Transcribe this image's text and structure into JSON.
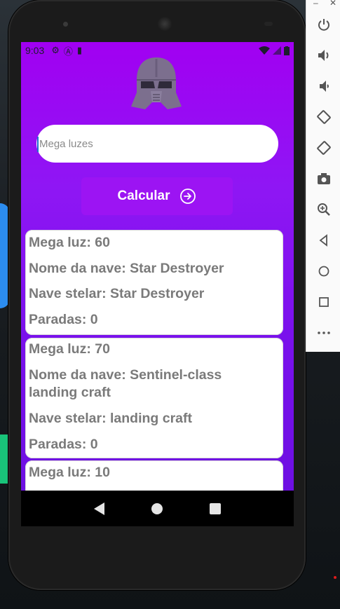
{
  "status_bar": {
    "time": "9:03"
  },
  "search": {
    "placeholder": "Mega luzes",
    "value": ""
  },
  "calculate_button": {
    "label": "Calcular"
  },
  "results": [
    {
      "lines": [
        "Mega luz: 60",
        "Nome da nave: Star Destroyer",
        "Nave stelar: Star Destroyer",
        "Paradas: 0"
      ]
    },
    {
      "lines": [
        "Mega luz: 70",
        "Nome da nave: Sentinel-class landing craft",
        "Nave stelar: landing craft",
        "Paradas: 0"
      ]
    },
    {
      "lines": [
        "Mega luz: 10"
      ]
    }
  ],
  "emulator_toolbar": {
    "items": [
      "power-icon",
      "volume-up-icon",
      "volume-down-icon",
      "rotate-left-icon",
      "rotate-right-icon",
      "camera-icon",
      "zoom-icon",
      "back-icon",
      "home-icon",
      "overview-icon",
      "more-icon"
    ]
  },
  "colors": {
    "accent": "#9c14f3",
    "screen_top": "#a100f2",
    "screen_bottom": "#6a0fe0"
  }
}
